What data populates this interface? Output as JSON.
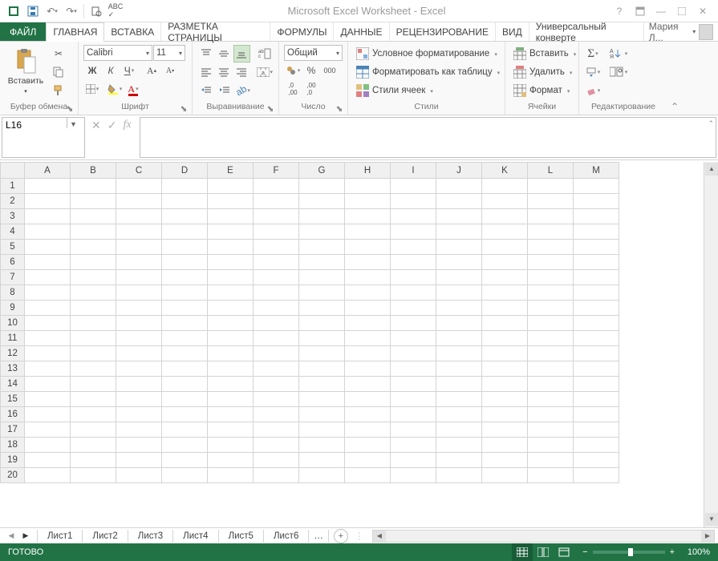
{
  "title": "Microsoft Excel Worksheet - Excel",
  "user": "Мария Л...",
  "tabs": {
    "file": "ФАЙЛ",
    "items": [
      "ГЛАВНАЯ",
      "ВСТАВКА",
      "РАЗМЕТКА СТРАНИЦЫ",
      "ФОРМУЛЫ",
      "ДАННЫЕ",
      "РЕЦЕНЗИРОВАНИЕ",
      "ВИД",
      "Универсальный конверте"
    ]
  },
  "ribbon": {
    "clipboard": {
      "paste": "Вставить",
      "label": "Буфер обмена"
    },
    "font": {
      "name": "Calibri",
      "size": "11",
      "bold": "Ж",
      "italic": "К",
      "underline": "Ч",
      "label": "Шрифт"
    },
    "align": {
      "label": "Выравнивание"
    },
    "number": {
      "format": "Общий",
      "label": "Число"
    },
    "styles": {
      "cond": "Условное форматирование",
      "table": "Форматировать как таблицу",
      "cell": "Стили ячеек",
      "label": "Стили"
    },
    "cells": {
      "insert": "Вставить",
      "delete": "Удалить",
      "format": "Формат",
      "label": "Ячейки"
    },
    "editing": {
      "label": "Редактирование"
    }
  },
  "formula": {
    "namebox": "L16"
  },
  "columns": [
    "A",
    "B",
    "C",
    "D",
    "E",
    "F",
    "G",
    "H",
    "I",
    "J",
    "K",
    "L",
    "M"
  ],
  "rows": [
    "1",
    "2",
    "3",
    "4",
    "5",
    "6",
    "7",
    "8",
    "9",
    "10",
    "11",
    "12",
    "13",
    "14",
    "15",
    "16",
    "17",
    "18",
    "19",
    "20"
  ],
  "sheets": [
    "Лист1",
    "Лист2",
    "Лист3",
    "Лист4",
    "Лист5",
    "Лист6"
  ],
  "status": {
    "ready": "ГОТОВО",
    "zoom": "100%"
  }
}
